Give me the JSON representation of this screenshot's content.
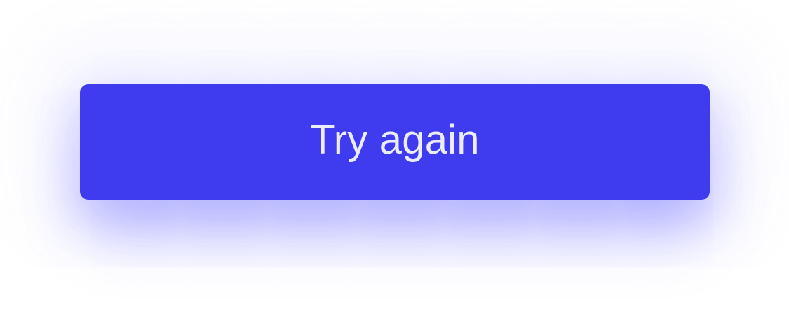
{
  "button": {
    "label": "Try again",
    "background_color": "#3f3cef",
    "text_color": "#ececff"
  }
}
